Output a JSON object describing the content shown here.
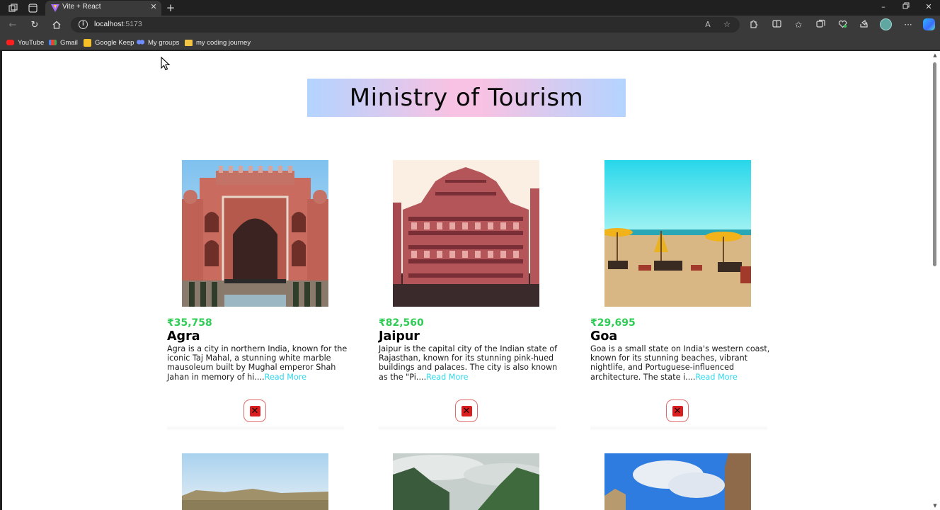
{
  "browser": {
    "tab_title": "Vite + React",
    "url_host": "localhost",
    "url_port": ":5173",
    "bookmarks": [
      "YouTube",
      "Gmail",
      "Google Keep",
      "My groups",
      "my coding journey"
    ]
  },
  "page": {
    "title": "Ministry of Tourism",
    "read_more": "Read More",
    "tours": [
      {
        "price": "₹35,758",
        "name": "Agra",
        "info": "Agra is a city in northern India, known for the iconic Taj Mahal, a stunning white marble mausoleum built by Mughal emperor Shah Jahan in memory of hi....",
        "image": "agra-gate-photo"
      },
      {
        "price": "₹82,560",
        "name": "Jaipur",
        "info": "Jaipur is the capital city of the Indian state of Rajasthan, known for its stunning pink-hued buildings and palaces. The city is also known as the \"Pi....",
        "image": "hawa-mahal-photo"
      },
      {
        "price": "₹29,695",
        "name": "Goa",
        "info": "Goa is a small state on India's western coast, known for its stunning beaches, vibrant nightlife, and Portuguese-influenced architecture. The state i....",
        "image": "goa-beach-photo"
      }
    ],
    "next_row_images": [
      "palace-riverfront-photo",
      "misty-hills-photo",
      "fort-sky-photo"
    ]
  },
  "colors": {
    "price": "#2ecc55",
    "read_more": "#2fd8ec",
    "remove_button_border": "#e06a6a",
    "remove_icon": "#d81e1e",
    "banner_blue": "#b3d4ff",
    "banner_pink": "#f7c2e3"
  },
  "icons": [
    "workspaces-icon",
    "tab-actions-icon",
    "back-icon",
    "refresh-icon",
    "home-icon",
    "site-info-icon",
    "read-aloud-icon",
    "favorite-star-icon",
    "extensions-icon",
    "split-screen-icon",
    "favorites-icon",
    "collections-icon",
    "browser-essentials-icon",
    "share-icon",
    "more-icon",
    "copilot-icon",
    "remove-icon"
  ]
}
